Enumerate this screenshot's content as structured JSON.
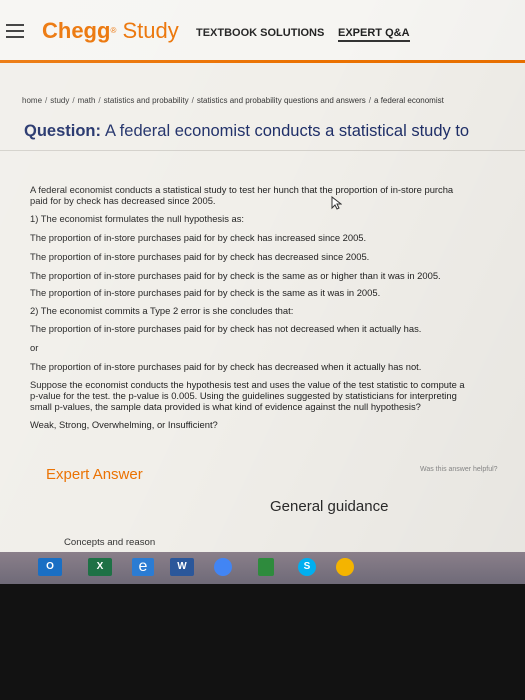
{
  "header": {
    "logo_chegg": "Chegg",
    "logo_tm": "®",
    "logo_study": "Study",
    "nav": [
      {
        "label": "TEXTBOOK SOLUTIONS"
      },
      {
        "label": "EXPERT Q&A"
      }
    ]
  },
  "breadcrumb": [
    "home",
    "study",
    "math",
    "statistics and probability",
    "statistics and probability questions and answers",
    "a federal economist"
  ],
  "question": {
    "label": "Question:",
    "title": "A federal economist conducts a statistical study to",
    "lines": [
      "A federal economist conducts a statistical study to test her hunch that the proportion of in-store purcha",
      "paid for by check has decreased since 2005.",
      "1) The economist formulates the null hypothesis as:",
      "The proportion of in-store purchases paid for by check has increased since 2005.",
      "The proportion of in-store purchases paid for by check has decreased since 2005.",
      "The proportion of in-store purchases paid for by check is the same as or higher than it was in 2005.",
      "The proportion of in-store purchases paid for by check is the same as it was in 2005.",
      "2) The economist commits a Type 2 error is she concludes that:",
      "The proportion of in-store purchases paid for by check has not decreased when it actually has.",
      "or",
      "The proportion of in-store purchases paid for by check has decreased when it actually has not.",
      "Suppose the economist conducts the hypothesis test and uses the value of the test statistic to compute a",
      "p-value for the test. the p-value is 0.005. Using the guidelines suggested by statisticians for interpreting",
      "small p-values, the sample data provided is what kind of evidence against the null hypothesis?",
      "Weak, Strong, Overwhelming, or Insufficient?"
    ]
  },
  "answer": {
    "heading": "Expert Answer",
    "helpful": "Was this answer helpful?",
    "general_guidance": "General guidance",
    "concepts": "Concepts and reason"
  },
  "taskbar": {
    "icons": [
      {
        "name": "outlook-icon",
        "label": "O",
        "color": "#1a6fc4"
      },
      {
        "name": "excel-icon",
        "label": "X",
        "color": "#1e7145"
      },
      {
        "name": "edge-icon",
        "label": "e",
        "color": "#2b7cd3"
      },
      {
        "name": "word-icon",
        "label": "W",
        "color": "#2b579a"
      },
      {
        "name": "chrome-icon",
        "label": "",
        "color": "#4285f4"
      },
      {
        "name": "app-icon",
        "label": "",
        "color": "#2e8b3d"
      },
      {
        "name": "skype-icon",
        "label": "S",
        "color": "#00aff0"
      },
      {
        "name": "google-icon",
        "label": "",
        "color": "#f4b400"
      }
    ]
  },
  "colors": {
    "brand": "#eb7100",
    "title": "#1f2f68"
  }
}
